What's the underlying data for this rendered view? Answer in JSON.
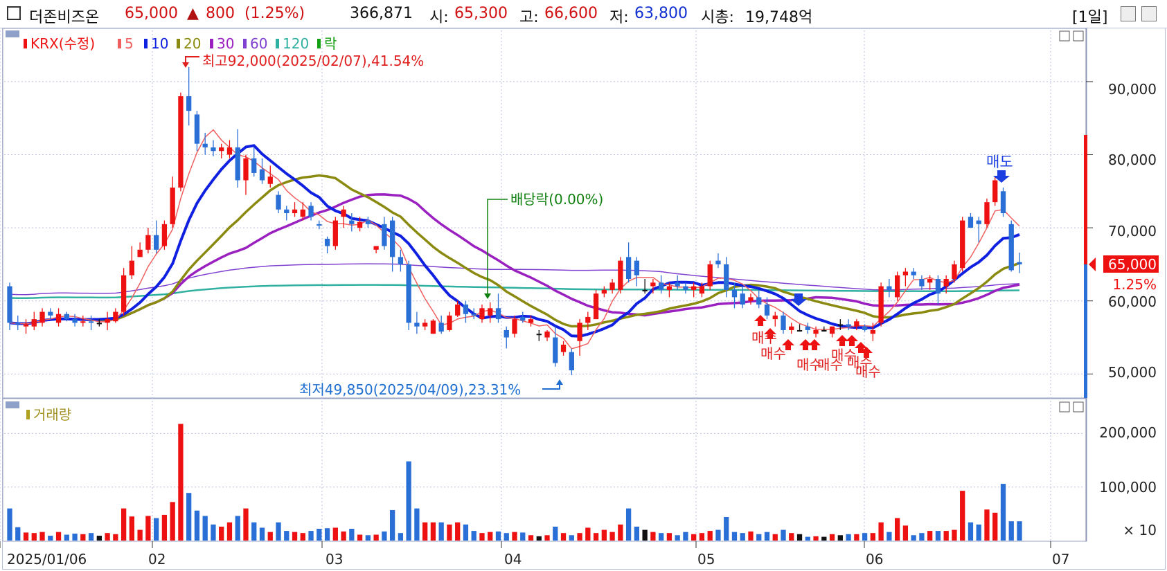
{
  "header": {
    "name": "더존비즈온",
    "price": "65,000",
    "change_arrow": "▲",
    "change": "800",
    "change_pct": "(1.25%)",
    "volume": "366,871",
    "open_label": "시:",
    "open": "65,300",
    "high_label": "고:",
    "high": "66,600",
    "low_label": "저:",
    "low": "63,800",
    "mcap_label": "시총:",
    "mcap": "19,748억",
    "period": "[1일]"
  },
  "legend": {
    "krx": "KRX(수정)",
    "ma": [
      "5",
      "10",
      "20",
      "30",
      "60",
      "120"
    ],
    "ex": "락",
    "volume": "거래량"
  },
  "annotations": {
    "high": "최고92,000(2025/02/07),41.54%",
    "low": "최저49,850(2025/04/09),23.31%",
    "dividend": "배당락(0.00%)",
    "sell": "매도",
    "buy": "매수"
  },
  "price_axis": [
    "90,000",
    "80,000",
    "70,000",
    "60,000",
    "50,000"
  ],
  "volume_axis": [
    "200,000",
    "100,000"
  ],
  "volume_unit": "× 10",
  "x_axis": [
    "2025/01/06",
    "02",
    "03",
    "04",
    "05",
    "06",
    "07"
  ],
  "current_price_tag": "65,000",
  "current_pct_tag": "1.25%",
  "colors": {
    "up": "#ee1111",
    "down": "#2a6fd6",
    "ma5": "#f06060",
    "ma10": "#1020e0",
    "ma20": "#8a8a10",
    "ma30": "#9a20c0",
    "ma60": "#8040d0",
    "ma120": "#30b0a0"
  },
  "chart_data": {
    "type": "candlestick",
    "y_range": [
      47000,
      97000
    ],
    "volume_range": [
      0,
      260000
    ],
    "candles": [
      {
        "o": 62000,
        "h": 62500,
        "l": 56000,
        "c": 57000,
        "v": 60000
      },
      {
        "o": 57000,
        "h": 58000,
        "l": 56000,
        "c": 56800,
        "v": 25000
      },
      {
        "o": 56500,
        "h": 57500,
        "l": 55500,
        "c": 56800,
        "v": 15000
      },
      {
        "o": 56500,
        "h": 58500,
        "l": 56000,
        "c": 57500,
        "v": 14000
      },
      {
        "o": 57000,
        "h": 59000,
        "l": 56500,
        "c": 58500,
        "v": 16000
      },
      {
        "o": 58500,
        "h": 59000,
        "l": 57500,
        "c": 58000,
        "v": 9000
      },
      {
        "o": 57000,
        "h": 59000,
        "l": 56500,
        "c": 58200,
        "v": 16000
      },
      {
        "o": 58200,
        "h": 58500,
        "l": 57200,
        "c": 57500,
        "v": 11000
      },
      {
        "o": 57500,
        "h": 58200,
        "l": 56500,
        "c": 57000,
        "v": 13000
      },
      {
        "o": 57000,
        "h": 58000,
        "l": 56500,
        "c": 57200,
        "v": 12000
      },
      {
        "o": 57200,
        "h": 58000,
        "l": 56000,
        "c": 57000,
        "v": 14000
      },
      {
        "o": 57000,
        "h": 57500,
        "l": 56500,
        "c": 57000,
        "v": 9000
      },
      {
        "o": 57000,
        "h": 58500,
        "l": 56000,
        "c": 57500,
        "v": 14000
      },
      {
        "o": 57200,
        "h": 59000,
        "l": 57000,
        "c": 58500,
        "v": 12000
      },
      {
        "o": 58500,
        "h": 64500,
        "l": 58000,
        "c": 63500,
        "v": 60000
      },
      {
        "o": 63500,
        "h": 67500,
        "l": 63000,
        "c": 65500,
        "v": 45000
      },
      {
        "o": 66000,
        "h": 68000,
        "l": 66000,
        "c": 67000,
        "v": 20000
      },
      {
        "o": 67000,
        "h": 70000,
        "l": 66500,
        "c": 69000,
        "v": 46000
      },
      {
        "o": 69000,
        "h": 71000,
        "l": 66500,
        "c": 67000,
        "v": 42000
      },
      {
        "o": 67500,
        "h": 71000,
        "l": 67000,
        "c": 70500,
        "v": 48000
      },
      {
        "o": 70500,
        "h": 77000,
        "l": 70000,
        "c": 75500,
        "v": 72000
      },
      {
        "o": 75500,
        "h": 88500,
        "l": 75000,
        "c": 88000,
        "v": 218000
      },
      {
        "o": 88000,
        "h": 92000,
        "l": 84000,
        "c": 86000,
        "v": 89000
      },
      {
        "o": 85500,
        "h": 86000,
        "l": 80500,
        "c": 81500,
        "v": 56000
      },
      {
        "o": 81500,
        "h": 83000,
        "l": 80000,
        "c": 81000,
        "v": 46000
      },
      {
        "o": 81000,
        "h": 82000,
        "l": 79800,
        "c": 80500,
        "v": 30000
      },
      {
        "o": 80500,
        "h": 81500,
        "l": 79500,
        "c": 81000,
        "v": 26000
      },
      {
        "o": 80000,
        "h": 82000,
        "l": 79500,
        "c": 81000,
        "v": 34000
      },
      {
        "o": 81000,
        "h": 83500,
        "l": 75500,
        "c": 76500,
        "v": 46000
      },
      {
        "o": 76500,
        "h": 80000,
        "l": 74500,
        "c": 79500,
        "v": 60000
      },
      {
        "o": 79500,
        "h": 81000,
        "l": 77000,
        "c": 77500,
        "v": 34000
      },
      {
        "o": 78000,
        "h": 79500,
        "l": 76000,
        "c": 76500,
        "v": 24000
      },
      {
        "o": 76000,
        "h": 78500,
        "l": 75500,
        "c": 77000,
        "v": 16000
      },
      {
        "o": 74500,
        "h": 75000,
        "l": 72000,
        "c": 72500,
        "v": 34000
      },
      {
        "o": 72500,
        "h": 73000,
        "l": 71000,
        "c": 72000,
        "v": 18000
      },
      {
        "o": 72000,
        "h": 73500,
        "l": 71500,
        "c": 72500,
        "v": 16000
      },
      {
        "o": 71500,
        "h": 73500,
        "l": 71000,
        "c": 72500,
        "v": 14000
      },
      {
        "o": 73000,
        "h": 73500,
        "l": 71000,
        "c": 71500,
        "v": 18000
      },
      {
        "o": 70500,
        "h": 71000,
        "l": 69800,
        "c": 70300,
        "v": 22000
      },
      {
        "o": 68500,
        "h": 68800,
        "l": 66500,
        "c": 67500,
        "v": 23000
      },
      {
        "o": 67500,
        "h": 71500,
        "l": 67000,
        "c": 71000,
        "v": 24000
      },
      {
        "o": 71500,
        "h": 73000,
        "l": 70000,
        "c": 72500,
        "v": 17000
      },
      {
        "o": 71000,
        "h": 72000,
        "l": 69500,
        "c": 70500,
        "v": 22000
      },
      {
        "o": 70000,
        "h": 71500,
        "l": 69500,
        "c": 70800,
        "v": 11000
      },
      {
        "o": 71000,
        "h": 71500,
        "l": 70000,
        "c": 70500,
        "v": 10000
      },
      {
        "o": 67000,
        "h": 67500,
        "l": 66500,
        "c": 67500,
        "v": 11000
      },
      {
        "o": 70500,
        "h": 71500,
        "l": 67000,
        "c": 67500,
        "v": 17000
      },
      {
        "o": 71000,
        "h": 71500,
        "l": 64000,
        "c": 66000,
        "v": 57000
      },
      {
        "o": 66000,
        "h": 67000,
        "l": 64000,
        "c": 65000,
        "v": 14000
      },
      {
        "o": 65000,
        "h": 65500,
        "l": 56000,
        "c": 57000,
        "v": 148000
      },
      {
        "o": 57000,
        "h": 58500,
        "l": 55500,
        "c": 56500,
        "v": 60000
      },
      {
        "o": 56500,
        "h": 57500,
        "l": 56000,
        "c": 57000,
        "v": 34000
      },
      {
        "o": 55500,
        "h": 57500,
        "l": 55500,
        "c": 57300,
        "v": 34000
      },
      {
        "o": 57000,
        "h": 58000,
        "l": 55500,
        "c": 55800,
        "v": 34000
      },
      {
        "o": 56000,
        "h": 58500,
        "l": 55800,
        "c": 58000,
        "v": 30000
      },
      {
        "o": 58000,
        "h": 60000,
        "l": 57800,
        "c": 59500,
        "v": 34000
      },
      {
        "o": 59500,
        "h": 60000,
        "l": 57000,
        "c": 58200,
        "v": 30000
      },
      {
        "o": 58200,
        "h": 59000,
        "l": 57500,
        "c": 58000,
        "v": 18000
      },
      {
        "o": 57500,
        "h": 59500,
        "l": 57000,
        "c": 59000,
        "v": 14000
      },
      {
        "o": 58000,
        "h": 59800,
        "l": 57000,
        "c": 59000,
        "v": 16000
      },
      {
        "o": 59000,
        "h": 61000,
        "l": 57000,
        "c": 57500,
        "v": 17000
      },
      {
        "o": 56000,
        "h": 56500,
        "l": 53500,
        "c": 55000,
        "v": 14000
      },
      {
        "o": 55500,
        "h": 58000,
        "l": 55000,
        "c": 57500,
        "v": 16000
      },
      {
        "o": 57800,
        "h": 58500,
        "l": 57000,
        "c": 57300,
        "v": 15000
      },
      {
        "o": 57000,
        "h": 58000,
        "l": 56500,
        "c": 57500,
        "v": 10000
      },
      {
        "o": 55500,
        "h": 56000,
        "l": 54500,
        "c": 55500,
        "v": 8000
      },
      {
        "o": 55000,
        "h": 56000,
        "l": 54500,
        "c": 55800,
        "v": 10000
      },
      {
        "o": 55000,
        "h": 56500,
        "l": 51000,
        "c": 51500,
        "v": 26000
      },
      {
        "o": 53000,
        "h": 54500,
        "l": 52500,
        "c": 54000,
        "v": 14000
      },
      {
        "o": 53000,
        "h": 53500,
        "l": 49850,
        "c": 50500,
        "v": 10000
      },
      {
        "o": 54500,
        "h": 57500,
        "l": 52500,
        "c": 57000,
        "v": 14000
      },
      {
        "o": 57000,
        "h": 58500,
        "l": 56000,
        "c": 57800,
        "v": 24000
      },
      {
        "o": 57500,
        "h": 61500,
        "l": 57500,
        "c": 61000,
        "v": 14000
      },
      {
        "o": 61000,
        "h": 62000,
        "l": 60500,
        "c": 61500,
        "v": 20000
      },
      {
        "o": 61500,
        "h": 63000,
        "l": 61000,
        "c": 62500,
        "v": 16000
      },
      {
        "o": 61500,
        "h": 66000,
        "l": 61000,
        "c": 65500,
        "v": 30000
      },
      {
        "o": 66000,
        "h": 68000,
        "l": 62500,
        "c": 63000,
        "v": 60000
      },
      {
        "o": 65500,
        "h": 66000,
        "l": 62000,
        "c": 63500,
        "v": 26000
      },
      {
        "o": 61500,
        "h": 63000,
        "l": 61000,
        "c": 61500,
        "v": 20000
      },
      {
        "o": 62000,
        "h": 63000,
        "l": 61000,
        "c": 62500,
        "v": 16000
      },
      {
        "o": 62500,
        "h": 63500,
        "l": 61000,
        "c": 61500,
        "v": 14000
      },
      {
        "o": 61500,
        "h": 62500,
        "l": 60500,
        "c": 62000,
        "v": 14000
      },
      {
        "o": 62500,
        "h": 63500,
        "l": 61500,
        "c": 62000,
        "v": 10000
      },
      {
        "o": 62000,
        "h": 62500,
        "l": 61000,
        "c": 61500,
        "v": 16000
      },
      {
        "o": 61500,
        "h": 62500,
        "l": 60500,
        "c": 62000,
        "v": 12000
      },
      {
        "o": 61000,
        "h": 62500,
        "l": 60500,
        "c": 62000,
        "v": 14000
      },
      {
        "o": 62000,
        "h": 65500,
        "l": 61500,
        "c": 65000,
        "v": 18000
      },
      {
        "o": 65500,
        "h": 66500,
        "l": 64500,
        "c": 65000,
        "v": 20000
      },
      {
        "o": 65000,
        "h": 66000,
        "l": 60500,
        "c": 61500,
        "v": 44000
      },
      {
        "o": 61500,
        "h": 62500,
        "l": 59000,
        "c": 60500,
        "v": 16000
      },
      {
        "o": 61000,
        "h": 62000,
        "l": 59000,
        "c": 59500,
        "v": 14000
      },
      {
        "o": 60000,
        "h": 61000,
        "l": 59500,
        "c": 60500,
        "v": 17000
      },
      {
        "o": 60500,
        "h": 61500,
        "l": 59000,
        "c": 59500,
        "v": 12000
      },
      {
        "o": 59500,
        "h": 60500,
        "l": 57500,
        "c": 58000,
        "v": 16000
      },
      {
        "o": 57500,
        "h": 58500,
        "l": 56500,
        "c": 58000,
        "v": 12000
      },
      {
        "o": 58000,
        "h": 58500,
        "l": 55500,
        "c": 56000,
        "v": 20000
      },
      {
        "o": 56000,
        "h": 57000,
        "l": 55500,
        "c": 56500,
        "v": 14000
      },
      {
        "o": 56000,
        "h": 56800,
        "l": 55800,
        "c": 56000,
        "v": 12000
      },
      {
        "o": 56500,
        "h": 57000,
        "l": 55500,
        "c": 56000,
        "v": 7000
      },
      {
        "o": 55500,
        "h": 56500,
        "l": 55000,
        "c": 56000,
        "v": 8000
      },
      {
        "o": 56000,
        "h": 56500,
        "l": 55800,
        "c": 56000,
        "v": 7000
      },
      {
        "o": 55500,
        "h": 56500,
        "l": 55000,
        "c": 56500,
        "v": 12000
      },
      {
        "o": 56800,
        "h": 57500,
        "l": 56000,
        "c": 56800,
        "v": 10000
      },
      {
        "o": 56800,
        "h": 57500,
        "l": 56000,
        "c": 56500,
        "v": 12000
      },
      {
        "o": 56500,
        "h": 57500,
        "l": 56000,
        "c": 57200,
        "v": 12000
      },
      {
        "o": 56500,
        "h": 56800,
        "l": 55800,
        "c": 56000,
        "v": 14000
      },
      {
        "o": 55500,
        "h": 57000,
        "l": 54500,
        "c": 56000,
        "v": 14000
      },
      {
        "o": 57000,
        "h": 62500,
        "l": 56500,
        "c": 62000,
        "v": 34000
      },
      {
        "o": 62000,
        "h": 63000,
        "l": 60500,
        "c": 61500,
        "v": 16000
      },
      {
        "o": 60500,
        "h": 64000,
        "l": 60000,
        "c": 63500,
        "v": 42000
      },
      {
        "o": 63500,
        "h": 64500,
        "l": 62000,
        "c": 64000,
        "v": 28000
      },
      {
        "o": 64000,
        "h": 64500,
        "l": 63000,
        "c": 63500,
        "v": 10000
      },
      {
        "o": 63000,
        "h": 63500,
        "l": 61500,
        "c": 62000,
        "v": 14000
      },
      {
        "o": 62500,
        "h": 63500,
        "l": 61500,
        "c": 63000,
        "v": 18000
      },
      {
        "o": 63000,
        "h": 63500,
        "l": 59500,
        "c": 61000,
        "v": 18000
      },
      {
        "o": 62000,
        "h": 63500,
        "l": 61000,
        "c": 63000,
        "v": 18000
      },
      {
        "o": 63000,
        "h": 65500,
        "l": 62500,
        "c": 65000,
        "v": 20000
      },
      {
        "o": 64500,
        "h": 71500,
        "l": 64000,
        "c": 71000,
        "v": 93000
      },
      {
        "o": 71500,
        "h": 72000,
        "l": 70000,
        "c": 70000,
        "v": 34000
      },
      {
        "o": 71000,
        "h": 71500,
        "l": 68000,
        "c": 70500,
        "v": 30000
      },
      {
        "o": 70500,
        "h": 74000,
        "l": 70000,
        "c": 73500,
        "v": 58000
      },
      {
        "o": 73500,
        "h": 77000,
        "l": 73000,
        "c": 76500,
        "v": 52000
      },
      {
        "o": 75000,
        "h": 75500,
        "l": 71500,
        "c": 72000,
        "v": 106000
      },
      {
        "o": 70500,
        "h": 71000,
        "l": 64000,
        "c": 64200,
        "v": 36000
      },
      {
        "o": 65300,
        "h": 66600,
        "l": 63800,
        "c": 65000,
        "v": 36000
      }
    ],
    "price_labels": [
      "90,000",
      "80,000",
      "70,000",
      "60,000",
      "50,000"
    ],
    "volume_labels": [
      "200,000",
      "100,000"
    ],
    "month_labels": [
      "2025/01/06",
      "02",
      "03",
      "04",
      "05",
      "06",
      "07"
    ]
  }
}
